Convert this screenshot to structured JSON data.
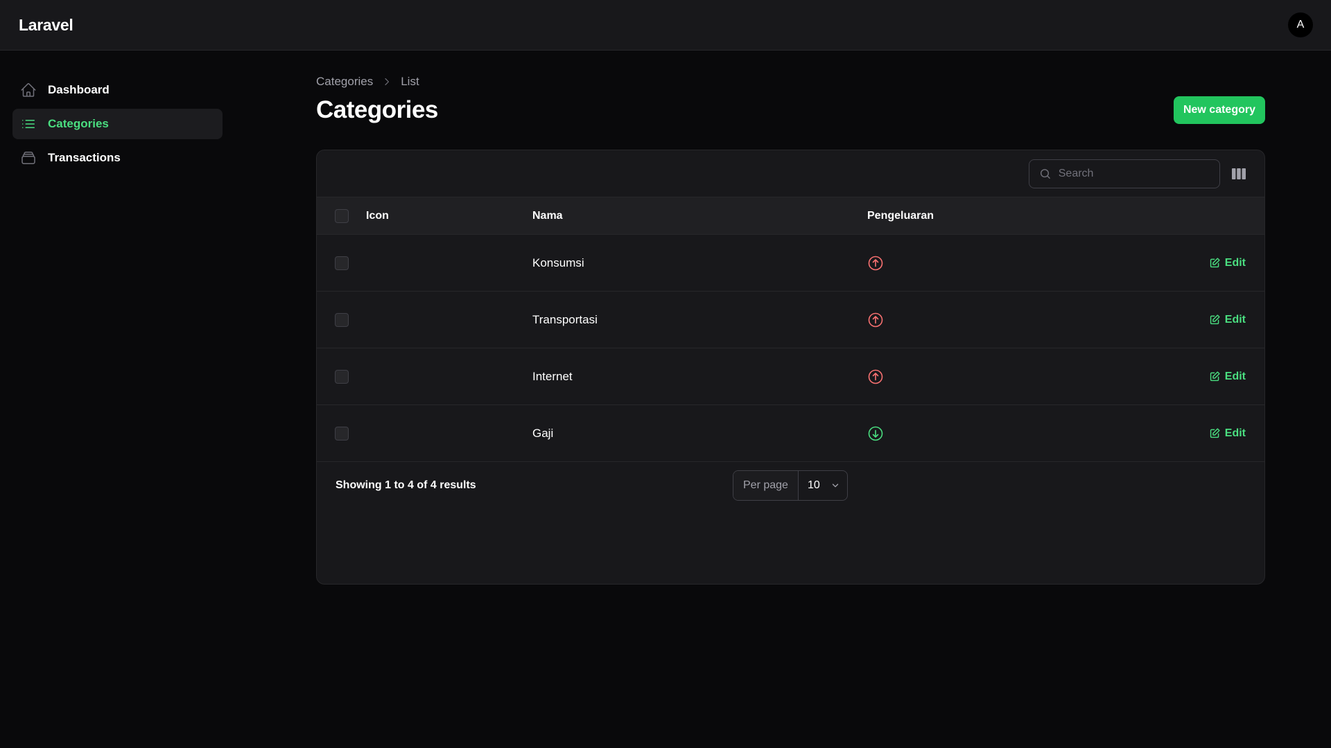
{
  "app": {
    "brand": "Laravel",
    "avatar_initial": "A"
  },
  "sidebar": {
    "items": [
      {
        "label": "Dashboard",
        "icon": "home-icon",
        "active": false
      },
      {
        "label": "Categories",
        "icon": "list-icon",
        "active": true
      },
      {
        "label": "Transactions",
        "icon": "archive-icon",
        "active": false
      }
    ]
  },
  "breadcrumb": {
    "parent": "Categories",
    "current": "List"
  },
  "page": {
    "title": "Categories",
    "new_button": "New category"
  },
  "table": {
    "search_placeholder": "Search",
    "columns": {
      "icon": "Icon",
      "nama": "Nama",
      "pengeluaran": "Pengeluaran"
    },
    "edit_label": "Edit",
    "rows": [
      {
        "icon": "",
        "nama": "Konsumsi",
        "pengeluaran": true
      },
      {
        "icon": "",
        "nama": "Transportasi",
        "pengeluaran": true
      },
      {
        "icon": "",
        "nama": "Internet",
        "pengeluaran": true
      },
      {
        "icon": "",
        "nama": "Gaji",
        "pengeluaran": false
      }
    ],
    "footer": {
      "result_text": "Showing 1 to 4 of 4 results",
      "per_page_label": "Per page",
      "per_page_value": "10"
    }
  },
  "colors": {
    "accent": "#22c55e",
    "accent_text": "#4ade80",
    "expense": "#f87171",
    "income": "#4ade80"
  }
}
